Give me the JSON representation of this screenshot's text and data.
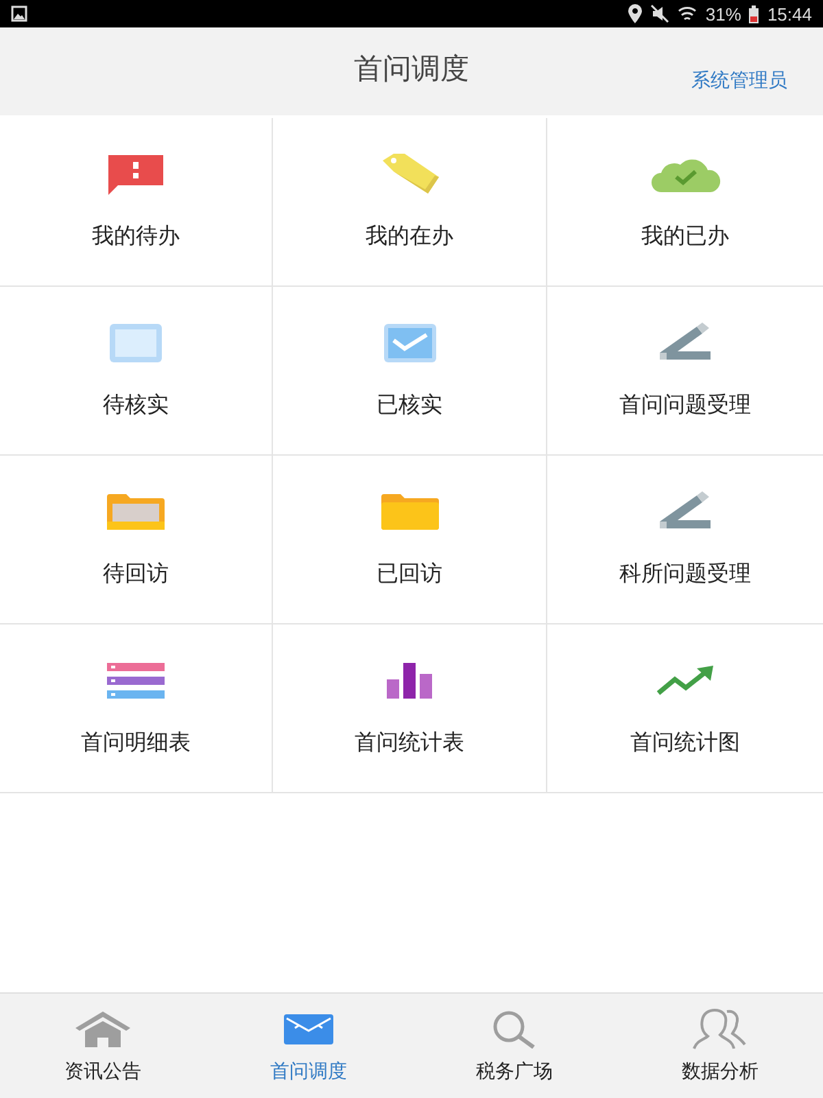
{
  "status_bar": {
    "battery": "31%",
    "time": "15:44"
  },
  "header": {
    "title": "首问调度",
    "user": "系统管理员"
  },
  "tiles": [
    {
      "label": "我的待办",
      "kind": "alert"
    },
    {
      "label": "我的在办",
      "kind": "tag"
    },
    {
      "label": "我的已办",
      "kind": "cloud"
    },
    {
      "label": "待核实",
      "kind": "blank"
    },
    {
      "label": "已核实",
      "kind": "checked"
    },
    {
      "label": "首问问题受理",
      "kind": "pen"
    },
    {
      "label": "待回访",
      "kind": "inbox"
    },
    {
      "label": "已回访",
      "kind": "folder"
    },
    {
      "label": "科所问题受理",
      "kind": "pen"
    },
    {
      "label": "首问明细表",
      "kind": "list"
    },
    {
      "label": "首问统计表",
      "kind": "bars"
    },
    {
      "label": "首问统计图",
      "kind": "trend"
    }
  ],
  "nav": [
    {
      "label": "资讯公告",
      "kind": "home",
      "selected": false
    },
    {
      "label": "首问调度",
      "kind": "mail",
      "selected": true
    },
    {
      "label": "税务广场",
      "kind": "search",
      "selected": false
    },
    {
      "label": "数据分析",
      "kind": "people",
      "selected": false
    }
  ]
}
